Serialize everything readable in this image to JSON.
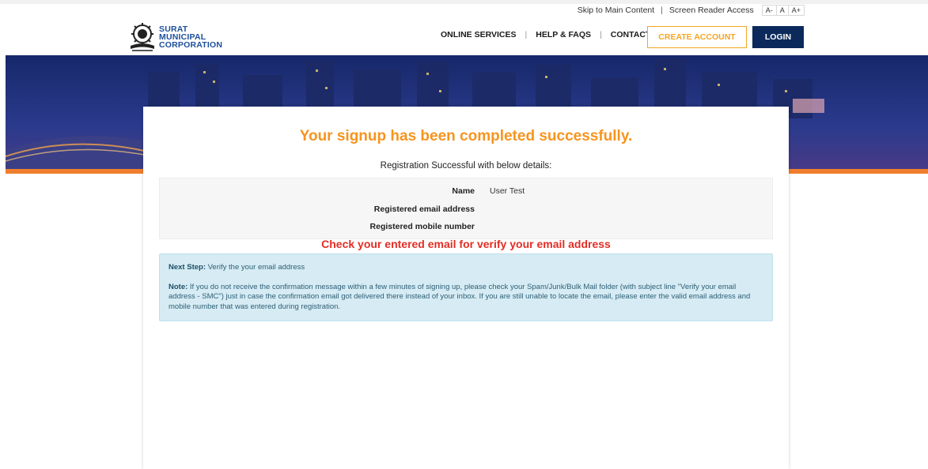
{
  "util": {
    "skip_link": "Skip to Main Content",
    "separator": "|",
    "screen_reader": "Screen Reader Access",
    "font_small": "A-",
    "font_normal": "A",
    "font_large": "A+"
  },
  "logo": {
    "line1": "SURAT",
    "line2": "MUNICIPAL",
    "line3": "CORPORATION"
  },
  "nav": {
    "online_services": "ONLINE SERVICES",
    "help_faqs": "HELP & FAQS",
    "contact": "CONTACT",
    "pipe": "|"
  },
  "actions": {
    "create_account": "CREATE ACCOUNT",
    "login": "LOGIN"
  },
  "main": {
    "success_title": "Your signup has been completed successfully.",
    "subtitle": "Registration Successful with below details:",
    "details": [
      {
        "label": "Name",
        "value": "User Test"
      },
      {
        "label": "Registered email address",
        "value": ""
      },
      {
        "label": "Registered mobile number",
        "value": ""
      }
    ],
    "check_email": "Check your entered email for verify your email address",
    "next_step_label": "Next Step:",
    "next_step_text": " Verify the your email address",
    "note_label": "Note:",
    "note_text": " If you do not receive the confirmation message within a few minutes of signing up, please check your Spam/Junk/Bulk Mail folder (with subject line \"Verify your email address - SMC\") just in case the confirmation email got delivered there instead of your inbox. If you are still unable to locate the email, please enter the valid email address and mobile number that was entered during registration."
  },
  "colors": {
    "accent_orange": "#f7941d",
    "navy": "#0b2a5b",
    "alert_red": "#e32d24",
    "info_bg": "#d6ebf3"
  }
}
